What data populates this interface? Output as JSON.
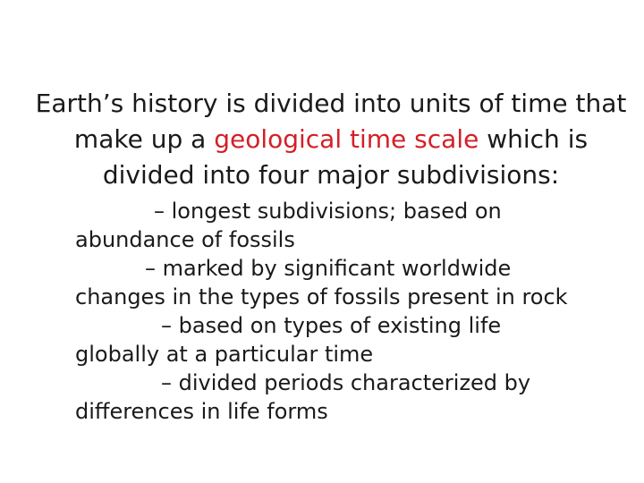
{
  "slide": {
    "intro": {
      "before": "Earth’s history is divided into units of time that make up a ",
      "highlight": "geological time scale",
      "after": " which is divided into four major subdivisions:"
    },
    "items": [
      {
        "description": "– longest subdivisions; based on abundance of fossils"
      },
      {
        "description": "– marked by significant worldwide changes in the types of fossils present in rock"
      },
      {
        "description": "– based on types of existing life globally at a particular time"
      },
      {
        "description": "– divided periods characterized by differences in life forms"
      }
    ],
    "colors": {
      "text": "#1a1a1a",
      "highlight": "#d32027",
      "background": "#ffffff"
    }
  }
}
